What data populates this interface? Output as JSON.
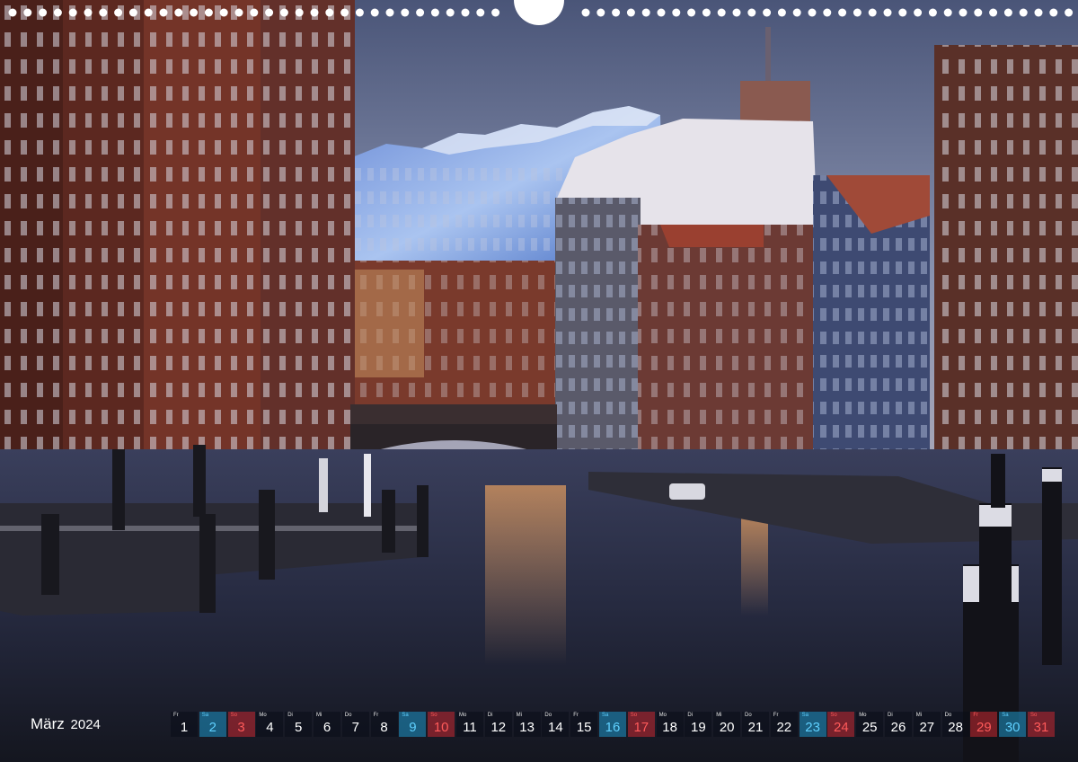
{
  "calendar": {
    "month": "März",
    "year": "2024",
    "days": [
      {
        "wd": "Fr",
        "n": "1",
        "type": ""
      },
      {
        "wd": "Sa",
        "n": "2",
        "type": "sa"
      },
      {
        "wd": "So",
        "n": "3",
        "type": "su"
      },
      {
        "wd": "Mo",
        "n": "4",
        "type": ""
      },
      {
        "wd": "Di",
        "n": "5",
        "type": ""
      },
      {
        "wd": "Mi",
        "n": "6",
        "type": ""
      },
      {
        "wd": "Do",
        "n": "7",
        "type": ""
      },
      {
        "wd": "Fr",
        "n": "8",
        "type": ""
      },
      {
        "wd": "Sa",
        "n": "9",
        "type": "sa"
      },
      {
        "wd": "So",
        "n": "10",
        "type": "su"
      },
      {
        "wd": "Mo",
        "n": "11",
        "type": ""
      },
      {
        "wd": "Di",
        "n": "12",
        "type": ""
      },
      {
        "wd": "Mi",
        "n": "13",
        "type": ""
      },
      {
        "wd": "Do",
        "n": "14",
        "type": ""
      },
      {
        "wd": "Fr",
        "n": "15",
        "type": ""
      },
      {
        "wd": "Sa",
        "n": "16",
        "type": "sa"
      },
      {
        "wd": "So",
        "n": "17",
        "type": "su"
      },
      {
        "wd": "Mo",
        "n": "18",
        "type": ""
      },
      {
        "wd": "Di",
        "n": "19",
        "type": ""
      },
      {
        "wd": "Mi",
        "n": "20",
        "type": ""
      },
      {
        "wd": "Do",
        "n": "21",
        "type": ""
      },
      {
        "wd": "Fr",
        "n": "22",
        "type": ""
      },
      {
        "wd": "Sa",
        "n": "23",
        "type": "sa"
      },
      {
        "wd": "So",
        "n": "24",
        "type": "su"
      },
      {
        "wd": "Mo",
        "n": "25",
        "type": ""
      },
      {
        "wd": "Di",
        "n": "26",
        "type": ""
      },
      {
        "wd": "Mi",
        "n": "27",
        "type": ""
      },
      {
        "wd": "Do",
        "n": "28",
        "type": ""
      },
      {
        "wd": "Fr",
        "n": "29",
        "type": "su"
      },
      {
        "wd": "Sa",
        "n": "30",
        "type": "sa"
      },
      {
        "wd": "So",
        "n": "31",
        "type": "su"
      }
    ]
  },
  "colors": {
    "saturday": "#1e96c8",
    "sunday": "#c82832"
  }
}
